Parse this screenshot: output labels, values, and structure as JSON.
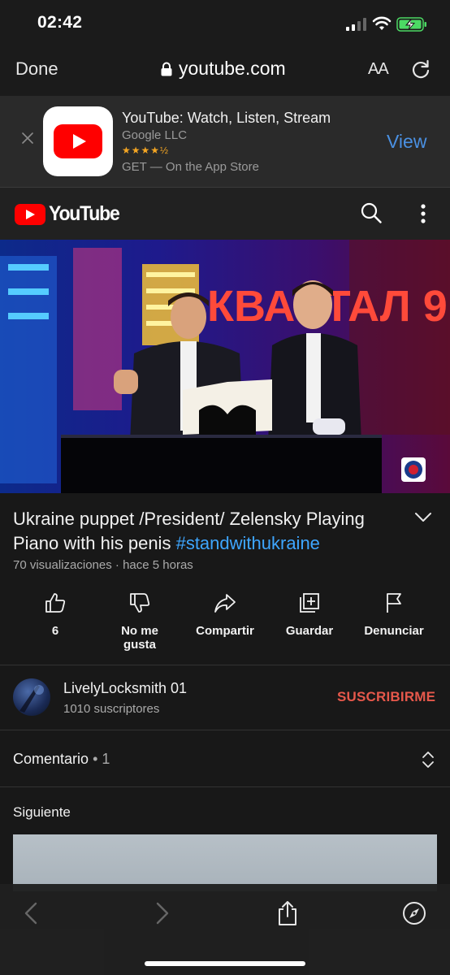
{
  "status": {
    "time": "02:42"
  },
  "safari": {
    "done_label": "Done",
    "url": "youtube.com",
    "text_size_label": "AA"
  },
  "app_banner": {
    "title": "YouTube: Watch, Listen, Stream",
    "developer": "Google LLC",
    "rating": "★★★★½",
    "get_text": "GET — On the App Store",
    "view_label": "View"
  },
  "header": {
    "logo_text": "YouTube"
  },
  "video": {
    "sign_text": "КВАРТАЛ 9",
    "title": "Ukraine puppet /President/ Zelensky Playing Piano with his penis",
    "hashtag": "#standwithukraine",
    "meta": "70 visualizaciones · hace 5 horas"
  },
  "actions": [
    {
      "label": "6",
      "icon": "thumbs-up-icon"
    },
    {
      "label": "No me gusta",
      "icon": "thumbs-down-icon"
    },
    {
      "label": "Compartir",
      "icon": "share-icon"
    },
    {
      "label": "Guardar",
      "icon": "add-to-playlist-icon"
    },
    {
      "label": "Denunciar",
      "icon": "flag-icon"
    }
  ],
  "channel": {
    "name": "LivelyLocksmith 01",
    "subscribers": "1010 suscriptores",
    "subscribe_label": "SUSCRIBIRME"
  },
  "comments": {
    "label": "Comentario",
    "count": "• 1"
  },
  "next": {
    "label": "Siguiente"
  },
  "colors": {
    "accent_blue": "#3ea6ff",
    "subscribe_red": "#e6584b",
    "youtube_red": "#ff0000",
    "background": "#181818"
  }
}
